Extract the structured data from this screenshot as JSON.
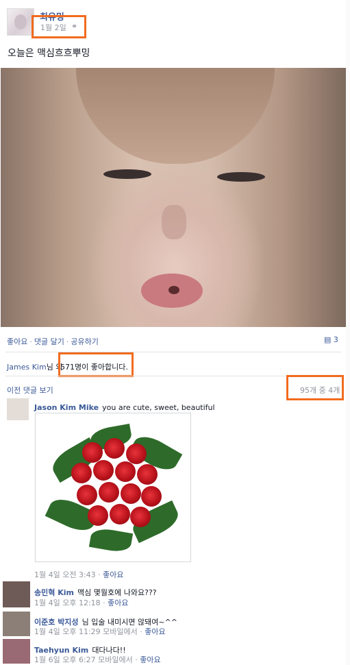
{
  "post": {
    "author": "최유밍",
    "timestamp": "1월 2일",
    "privacy_icon": "globe-icon",
    "text": "오늘은 맥심흐흐뿌밍"
  },
  "actions": {
    "like": "좋아요",
    "comment": "댓글 달기",
    "share": "공유하기",
    "comment_count": "3"
  },
  "likes": {
    "name": "James Kim",
    "suffix": "님 외",
    "count": "571명이 좋아합니다."
  },
  "comments_header": {
    "prev_link": "이전 댓글 보기",
    "count": "95개 중 4개"
  },
  "comments": [
    {
      "name": "Jason Kim Mike",
      "text": "you are cute, sweet, beautiful",
      "time": "1월 4일 오전 3:43",
      "via": "",
      "like": "좋아요"
    },
    {
      "name": "송민혁 Kim",
      "text": "맥심 몇월호에 나와요???",
      "time": "1월 4일 오후 12:18",
      "via": "",
      "like": "좋아요"
    },
    {
      "name": "이준호 박지성",
      "text": "님 입술 내미시면 않돼여~^^",
      "time": "1월 4일 오후 11:29",
      "via": "모바일에서",
      "like": "좋아요"
    },
    {
      "name": "Taehyun Kim",
      "text": "대다나다!!",
      "time": "1월 6일 오후 6:27",
      "via": "모바일에서",
      "like": "좋아요"
    }
  ],
  "colors": {
    "link": "#3b5998",
    "highlight": "#f26b1d",
    "muted": "#90949c"
  }
}
